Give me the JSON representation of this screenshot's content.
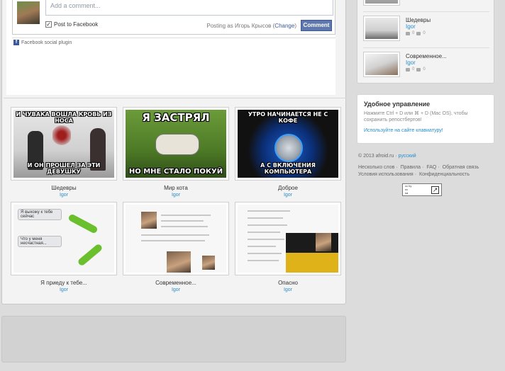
{
  "facebook": {
    "input_placeholder": "Add a comment...",
    "post_to_facebook_label": "Post to Facebook",
    "post_checkbox_checked": true,
    "posting_as_prefix": "Posting as Игорь Крысов (",
    "change_label": "Change",
    "posting_as_suffix": ")",
    "comment_button": "Comment",
    "plugin_label": "Facebook social plugin"
  },
  "thumbnails": [
    {
      "top_text": "И ЧУВАКА ВОШЛА КРОВЬ ИЗ НОСА",
      "bottom_text": "И ОН ПРОШЕЛ ЗА ЭТИ ДЕВУШКУ",
      "title": "Шедевры",
      "author": "Igor"
    },
    {
      "top_text": "Я ЗАСТРЯЛ",
      "bottom_text": "НО МНЕ СТАЛО ПОКУЙ",
      "title": "Мир кота",
      "author": "Igor"
    },
    {
      "top_text": "УТРО НАЧИНАЕТСЯ НЕ С КОФЕ",
      "bottom_text": "А С ВКЛЮЧЕНИЯ КОМПЬЮТЕРА",
      "title": "Доброе",
      "author": "Igor"
    },
    {
      "chat_1": "Я выхожу к тебе сейчас",
      "chat_2": "Что у меня несчастная...",
      "title": "Я приеду к тебе...",
      "author": "Igor"
    },
    {
      "title": "Современное...",
      "author": "Igor"
    },
    {
      "title": "Опасно",
      "author": "Igor"
    }
  ],
  "sidebar": {
    "items": [
      {
        "title": "",
        "author": ""
      },
      {
        "title": "Шедевры",
        "author": "Igor"
      },
      {
        "title": "Современное...",
        "author": "Igor"
      }
    ],
    "stats_zero": "0"
  },
  "tips": {
    "title": "Удобное управление",
    "text": "Нажмите Ctrl + D или ⌘ + D (Mac OS), чтобы сохранить репостбертов!",
    "link": "Используйте на сайте клавиатуру!"
  },
  "footer": {
    "copyright": "© 2013 afroid.ru ·",
    "language": "русский",
    "links": [
      "Несколько слов",
      "Правила",
      "FAQ",
      "Обратная связь"
    ],
    "links2": [
      "Условия использования",
      "Конфиденциальность"
    ],
    "cc_line1": "cc by",
    "cc_line2": "nc",
    "cc_line3": "sa"
  }
}
